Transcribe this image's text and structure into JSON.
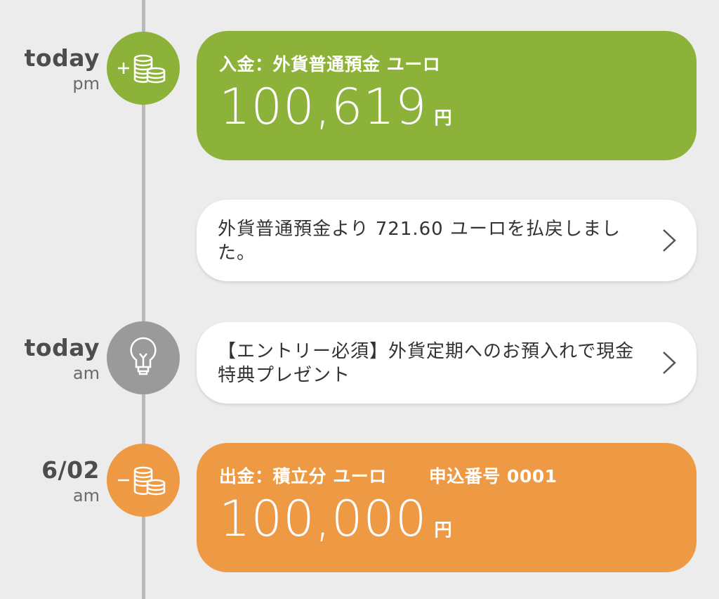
{
  "timeline": [
    {
      "date": "today",
      "time": "pm",
      "icon": "coins-plus-icon",
      "color": "#8cb23a",
      "title": "入金：外貨普通預金 ユーロ",
      "amount": "100,619",
      "unit": "円"
    },
    {
      "message": "外貨普通預金より 721.60 ユーロを払戻しました。"
    },
    {
      "date": "today",
      "time": "am",
      "icon": "lightbulb-icon",
      "color": "#9a9a9a",
      "message": "【エントリー必須】外貨定期へのお預入れで現金特典プレゼント"
    },
    {
      "date": "6/02",
      "time": "am",
      "icon": "coins-minus-icon",
      "color": "#ee9a45",
      "title": "出金：積立分 ユーロ",
      "order_label": "申込番号 0001",
      "amount": "100,000",
      "unit": "円"
    }
  ]
}
